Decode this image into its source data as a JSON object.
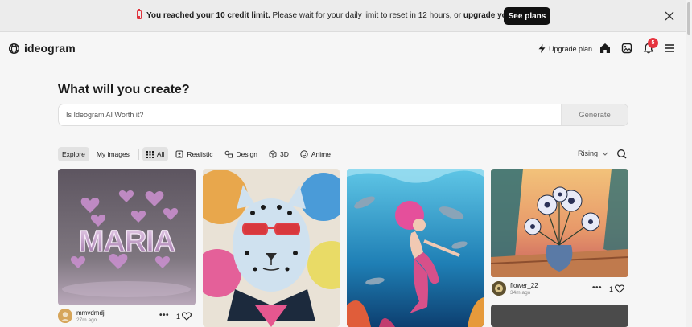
{
  "banner": {
    "msg_bold": "You reached your 10 credit limit.",
    "msg_middle": " Please wait for your daily limit to reset in 12 hours, or ",
    "msg_link": "upgrade your plan.",
    "cta": "See plans"
  },
  "header": {
    "logo": "ideogram",
    "upgrade": "Upgrade plan",
    "notification_count": "5"
  },
  "main": {
    "title": "What will you create?",
    "prompt_value": "Is Ideogram AI Worth it?",
    "generate": "Generate"
  },
  "filters": {
    "tabs": [
      "Explore",
      "My images"
    ],
    "styles": [
      "All",
      "Realistic",
      "Design",
      "3D",
      "Anime"
    ],
    "sort": "Rising"
  },
  "feed": [
    {
      "user": "mmvdmdj",
      "time": "27m ago",
      "likes": "1",
      "image_text": "MARIA"
    },
    {
      "user": "",
      "time": "",
      "likes": ""
    },
    {
      "user": "",
      "time": "",
      "likes": ""
    },
    {
      "user": "flower_22",
      "time": "34m ago",
      "likes": "1"
    }
  ],
  "colors": {
    "accent_red": "#e6343f",
    "dark_button": "#111111",
    "background": "#f6f6f6"
  }
}
